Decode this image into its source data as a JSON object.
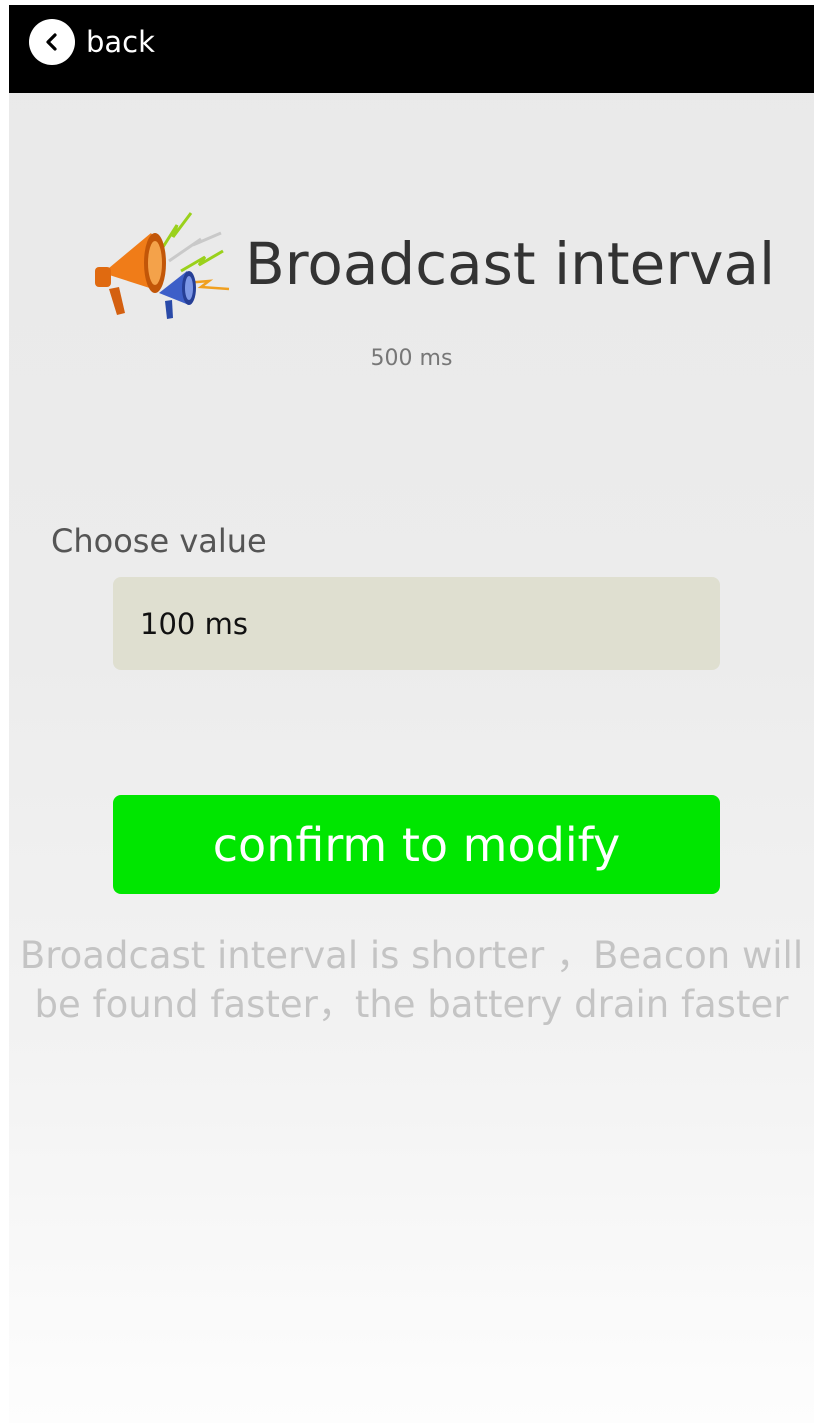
{
  "topbar": {
    "back_icon": "chevron-left-icon",
    "back_label": "back"
  },
  "header": {
    "icon": "megaphone-icon",
    "title": "Broadcast interval",
    "current_value": "500 ms"
  },
  "form": {
    "choose_label": "Choose value",
    "selected_value": "100 ms",
    "confirm_label": "confirm to modify"
  },
  "hint": {
    "line1": "Broadcast interval is shorter ，Beacon will",
    "line2": "be found faster，the battery drain faster"
  },
  "colors": {
    "topbar": "#000000",
    "confirm_button": "#00e600",
    "select_background": "#dfdfd0",
    "hint_text": "#c4c4c4"
  }
}
